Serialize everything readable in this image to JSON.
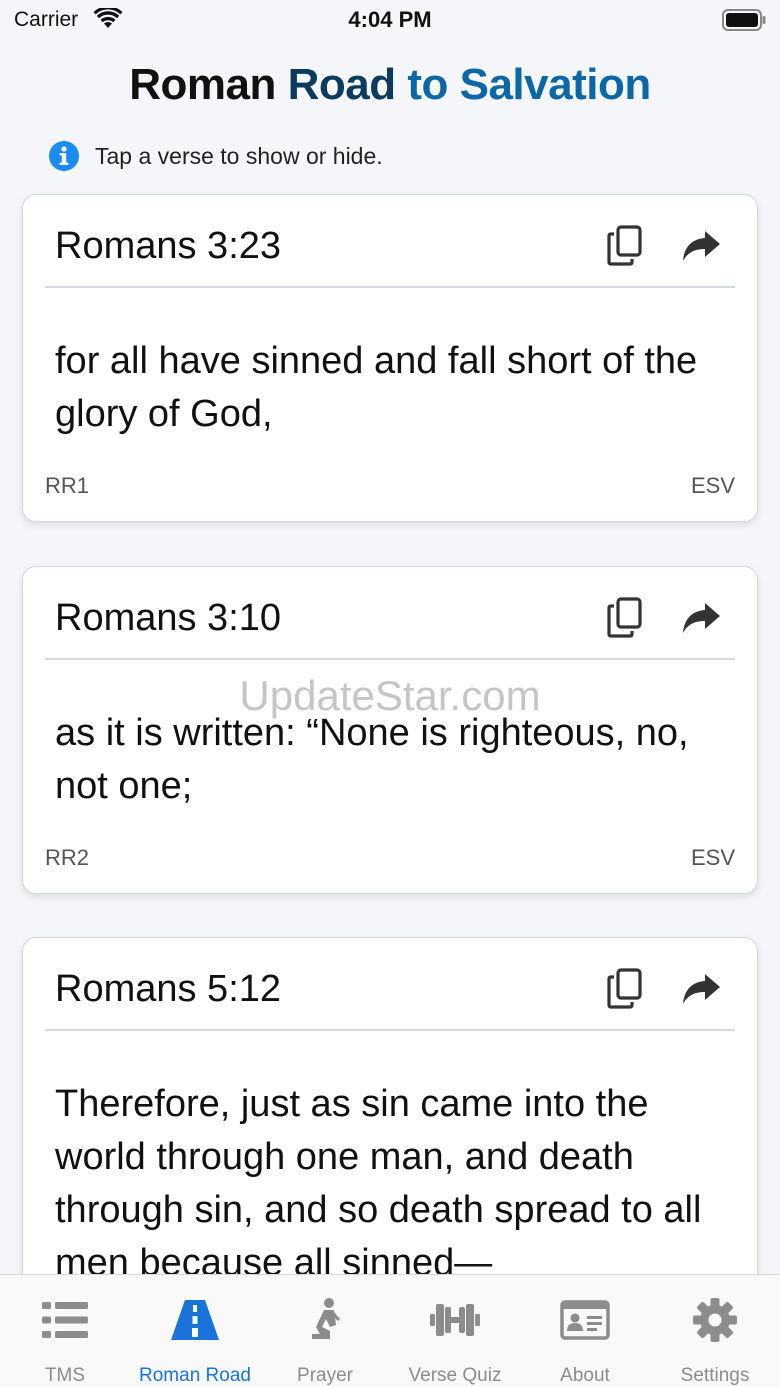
{
  "status_bar": {
    "carrier": "Carrier",
    "time": "4:04 PM"
  },
  "header": {
    "title_part1": "Roman",
    "title_part2": "Road",
    "title_part3": "to Salvation",
    "hint": "Tap a verse to show or hide."
  },
  "cards": [
    {
      "reference": "Romans 3:23",
      "text": "for all have sinned and fall short of the glory of God,",
      "code": "RR1",
      "version": "ESV"
    },
    {
      "reference": "Romans 3:10",
      "text": "as it is written: “None is righteous, no, not one;",
      "code": "RR2",
      "version": "ESV"
    },
    {
      "reference": "Romans 5:12",
      "text": "Therefore, just as sin came into the world through one man, and death through sin, and so death spread to all men because all sinned—",
      "code": "",
      "version": ""
    }
  ],
  "watermark": "UpdateStar.com",
  "tabs": [
    {
      "label": "TMS",
      "icon": "list-icon"
    },
    {
      "label": "Roman Road",
      "icon": "road-icon"
    },
    {
      "label": "Prayer",
      "icon": "praying-person-icon"
    },
    {
      "label": "Verse Quiz",
      "icon": "dumbbell-icon"
    },
    {
      "label": "About",
      "icon": "id-card-icon"
    },
    {
      "label": "Settings",
      "icon": "gear-icon"
    }
  ],
  "colors": {
    "active_tab": "#1a73d9",
    "inactive_tab": "#8c8c8c",
    "title_dark": "#0b3c5d",
    "title_blue": "#0a68a6",
    "info": "#1a8cf0"
  }
}
